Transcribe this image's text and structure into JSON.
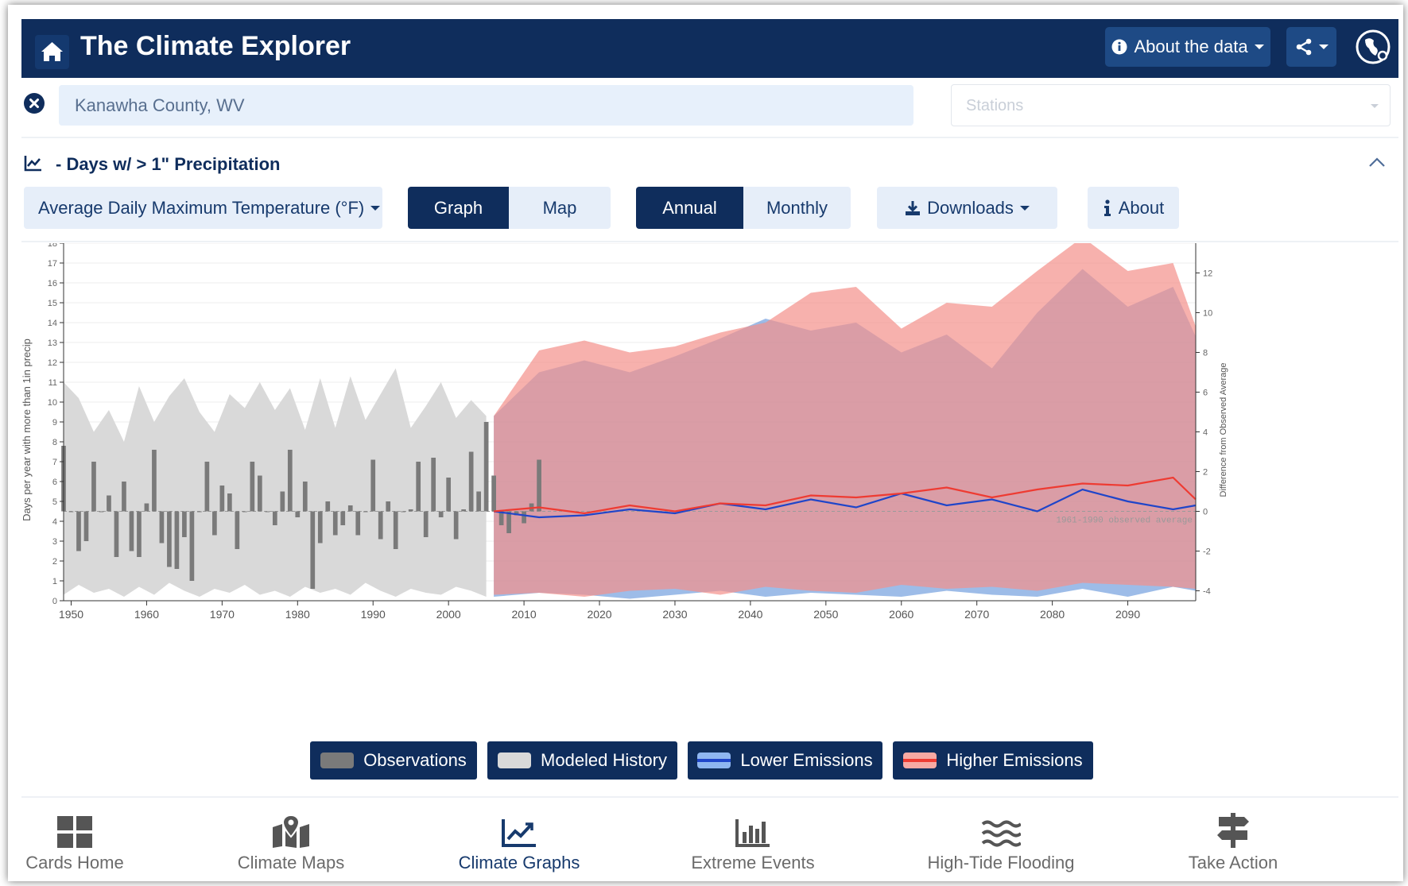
{
  "header": {
    "title": "The Climate Explorer",
    "about_data_label": "About the data"
  },
  "location": {
    "value": "Kanawha County, WV",
    "stations_placeholder": "Stations"
  },
  "variable": {
    "title": "- Days w/ > 1\" Precipitation",
    "select_value": "Average Daily Maximum Temperature (°F)"
  },
  "toolbar": {
    "graph_label": "Graph",
    "map_label": "Map",
    "annual_label": "Annual",
    "monthly_label": "Monthly",
    "downloads_label": "Downloads",
    "about_label": "About"
  },
  "legend": {
    "observations": "Observations",
    "modeled_history": "Modeled History",
    "lower_emissions": "Lower Emissions",
    "higher_emissions": "Higher Emissions"
  },
  "nav": [
    {
      "label": "Cards Home",
      "icon": "grid-icon"
    },
    {
      "label": "Climate Maps",
      "icon": "map-marker-icon"
    },
    {
      "label": "Climate Graphs",
      "icon": "line-chart-icon"
    },
    {
      "label": "Extreme Events",
      "icon": "bar-chart-icon"
    },
    {
      "label": "High-Tide Flooding",
      "icon": "waves-icon"
    },
    {
      "label": "Take Action",
      "icon": "signpost-icon"
    }
  ],
  "colors": {
    "navy": "#0f2d5c",
    "observations": "#7a7a7a",
    "modeled_history": "#d9d9d9",
    "lower_emissions": "#5b8fd9",
    "higher_emissions": "#f4908a",
    "lower_line": "#1f45c9",
    "higher_line": "#ee3b32"
  },
  "chart_data": {
    "type": "area",
    "ylabel": "Days per year with more than 1in precip",
    "y2label": "Difference from Observed Average",
    "baseline_label": "1961-1990 observed average",
    "baseline_value": 4.5,
    "ylim": [
      0,
      18
    ],
    "y2lim": [
      -4.5,
      13.5
    ],
    "yticks": [
      0,
      1,
      2,
      3,
      4,
      5,
      6,
      7,
      8,
      9,
      10,
      11,
      12,
      13,
      14,
      15,
      16,
      17,
      18
    ],
    "y2ticks": [
      -4,
      -2,
      0,
      2,
      4,
      6,
      8,
      10,
      12
    ],
    "xlim": [
      1949,
      2099
    ],
    "xticks": [
      1950,
      1960,
      1970,
      1980,
      1990,
      2000,
      2010,
      2020,
      2030,
      2040,
      2050,
      2060,
      2070,
      2080,
      2090
    ],
    "grid": true,
    "observations": {
      "years": [
        1949,
        1950,
        1951,
        1952,
        1953,
        1954,
        1955,
        1956,
        1957,
        1958,
        1959,
        1960,
        1961,
        1962,
        1963,
        1964,
        1965,
        1966,
        1967,
        1968,
        1969,
        1970,
        1971,
        1972,
        1973,
        1974,
        1975,
        1976,
        1977,
        1978,
        1979,
        1980,
        1981,
        1982,
        1983,
        1984,
        1985,
        1986,
        1987,
        1988,
        1989,
        1990,
        1991,
        1992,
        1993,
        1994,
        1995,
        1996,
        1997,
        1998,
        1999,
        2000,
        2001,
        2002,
        2003,
        2004,
        2005,
        2006,
        2007,
        2008,
        2009,
        2010,
        2011,
        2012
      ],
      "values": [
        7.8,
        4.5,
        2.5,
        3,
        7,
        4.5,
        5.3,
        2.2,
        6,
        2.5,
        2.2,
        4.9,
        7.6,
        2.9,
        1.7,
        1.6,
        3.2,
        1,
        4.5,
        7,
        3.3,
        5.8,
        5.4,
        2.6,
        4.5,
        7,
        6.3,
        4.5,
        3.8,
        5.5,
        7.6,
        4.2,
        6,
        0.6,
        2.9,
        5,
        3.3,
        3.8,
        4.8,
        3.3,
        4.5,
        7.1,
        3.1,
        5,
        2.6,
        4.5,
        4.6,
        7,
        3.2,
        7.2,
        4.2,
        6.2,
        3.1,
        4.6,
        7.5,
        5.5,
        9,
        6.3,
        3.8,
        3.4,
        4.3,
        3.9,
        4.9,
        7.1,
        7.2,
        3.8
      ]
    },
    "modeled_history": {
      "years": [
        1949,
        1951,
        1953,
        1955,
        1957,
        1959,
        1961,
        1963,
        1965,
        1967,
        1969,
        1971,
        1973,
        1975,
        1977,
        1979,
        1981,
        1983,
        1985,
        1987,
        1989,
        1991,
        1993,
        1995,
        1997,
        1999,
        2001,
        2003,
        2005
      ],
      "low": [
        0.3,
        0.8,
        0.4,
        0.6,
        0.2,
        0.7,
        0.3,
        0.9,
        0.5,
        0.2,
        0.6,
        0.4,
        0.8,
        0.3,
        0.5,
        0.2,
        0.7,
        0.4,
        0.6,
        0.3,
        0.9,
        0.5,
        0.2,
        0.6,
        0.4,
        0.3,
        0.7,
        0.5,
        0.2
      ],
      "high": [
        11,
        10.2,
        8.5,
        9.6,
        8,
        10.8,
        9,
        10.3,
        11.2,
        9.5,
        8.5,
        10.4,
        9.7,
        11,
        9.6,
        10.7,
        8.6,
        11.2,
        8.7,
        11.3,
        9.1,
        10.4,
        11.7,
        8.7,
        9.8,
        11,
        9.2,
        10.1,
        9.3
      ]
    },
    "series": [
      {
        "name": "Lower Emissions",
        "years": [
          2006,
          2012,
          2018,
          2024,
          2030,
          2036,
          2042,
          2048,
          2054,
          2060,
          2066,
          2072,
          2078,
          2084,
          2090,
          2096,
          2099
        ],
        "low": [
          0.2,
          0.4,
          0.3,
          0.1,
          0.3,
          0.5,
          0.2,
          0.4,
          0.3,
          0.2,
          0.5,
          0.3,
          0.2,
          0.6,
          0.2,
          0.7,
          0.5
        ],
        "high": [
          9.3,
          11.5,
          12.1,
          11.5,
          12.3,
          13.2,
          14.2,
          13.6,
          14,
          12.5,
          13.4,
          11.7,
          14.5,
          16.7,
          14.8,
          15.8,
          13.3
        ],
        "median": [
          4.5,
          4.2,
          4.3,
          4.6,
          4.4,
          4.9,
          4.6,
          5.1,
          4.7,
          5.4,
          4.8,
          5.1,
          4.5,
          5.6,
          5,
          4.6,
          4.8
        ]
      },
      {
        "name": "Higher Emissions",
        "years": [
          2006,
          2012,
          2018,
          2024,
          2030,
          2036,
          2042,
          2048,
          2054,
          2060,
          2066,
          2072,
          2078,
          2084,
          2090,
          2096,
          2099
        ],
        "low": [
          0.3,
          0.4,
          0.2,
          0.5,
          0.6,
          0.3,
          0.7,
          0.5,
          0.4,
          0.8,
          0.6,
          0.7,
          0.5,
          0.9,
          0.8,
          0.7,
          0.6
        ],
        "high": [
          9.3,
          12.6,
          13.1,
          12.5,
          12.8,
          13.5,
          14,
          15.5,
          15.8,
          13.7,
          15,
          14.8,
          16.6,
          18.3,
          16.6,
          17,
          13.8
        ],
        "median": [
          4.5,
          4.7,
          4.4,
          4.8,
          4.5,
          4.9,
          4.8,
          5.3,
          5.2,
          5.4,
          5.7,
          5.2,
          5.6,
          5.9,
          5.8,
          6.2,
          5.1
        ]
      }
    ]
  }
}
